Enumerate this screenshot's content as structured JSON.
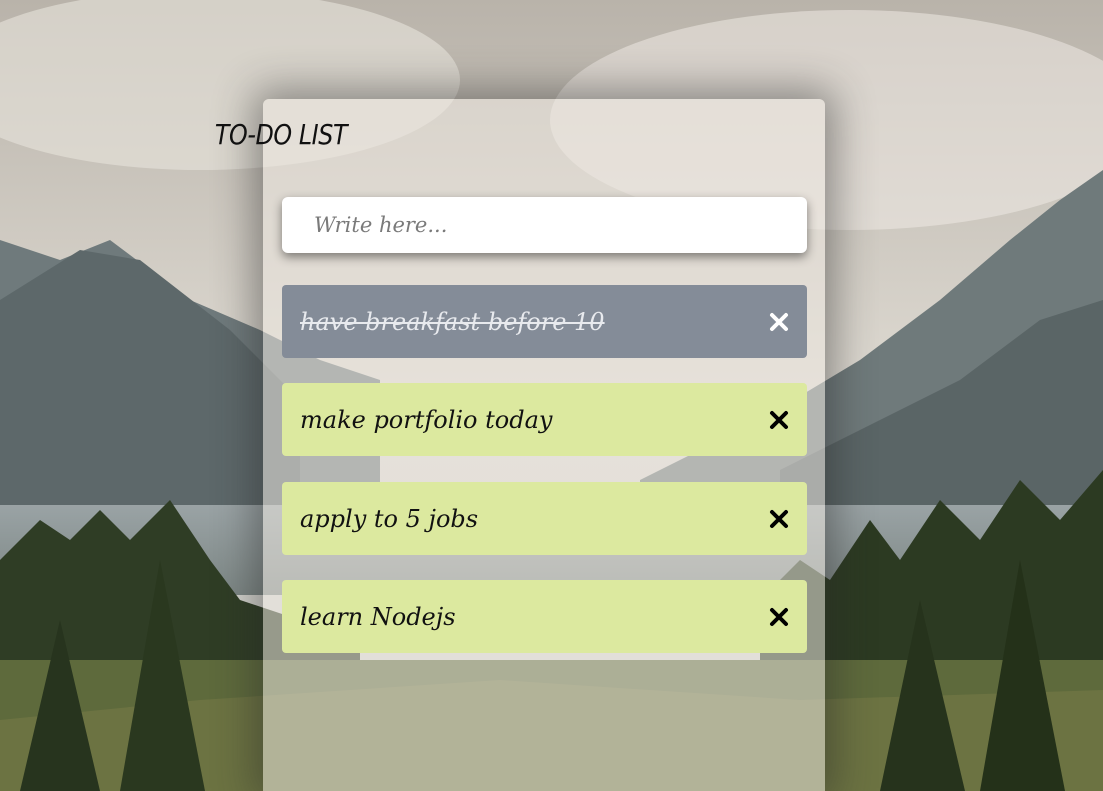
{
  "app": {
    "title": "TO-DO LIST"
  },
  "input": {
    "placeholder": "Write here...",
    "value": ""
  },
  "todos": [
    {
      "text": "have breakfast before 10",
      "done": true
    },
    {
      "text": "make portfolio today",
      "done": false
    },
    {
      "text": "apply to 5 jobs",
      "done": false
    },
    {
      "text": "learn Nodejs",
      "done": false
    }
  ],
  "colors": {
    "done_item": "#848c98",
    "pending_item": "#dce99f",
    "card": "#ece8e0"
  },
  "icons": {
    "delete": "close-icon"
  }
}
